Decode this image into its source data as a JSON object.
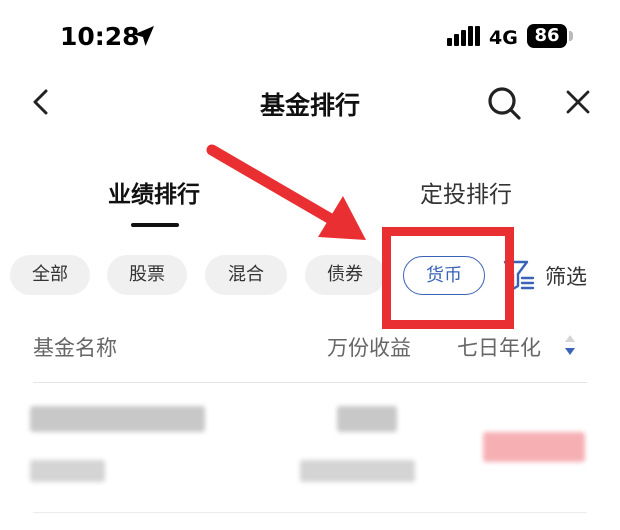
{
  "status_bar": {
    "time": "10:28",
    "network": "4G",
    "battery": "86"
  },
  "nav": {
    "title": "基金排行"
  },
  "tabs": [
    {
      "label": "业绩排行",
      "active": true
    },
    {
      "label": "定投排行",
      "active": false
    }
  ],
  "chips": [
    {
      "label": "全部",
      "selected": false
    },
    {
      "label": "股票",
      "selected": false
    },
    {
      "label": "混合",
      "selected": false
    },
    {
      "label": "债券",
      "selected": false
    },
    {
      "label": "货币",
      "selected": true
    }
  ],
  "filter": {
    "label": "筛选"
  },
  "table": {
    "columns": [
      "基金名称",
      "万份收益",
      "七日年化"
    ]
  },
  "colors": {
    "accent": "#3a63b8",
    "annotation_red": "#ea2f32",
    "positive_red": "#f6b0b4"
  }
}
